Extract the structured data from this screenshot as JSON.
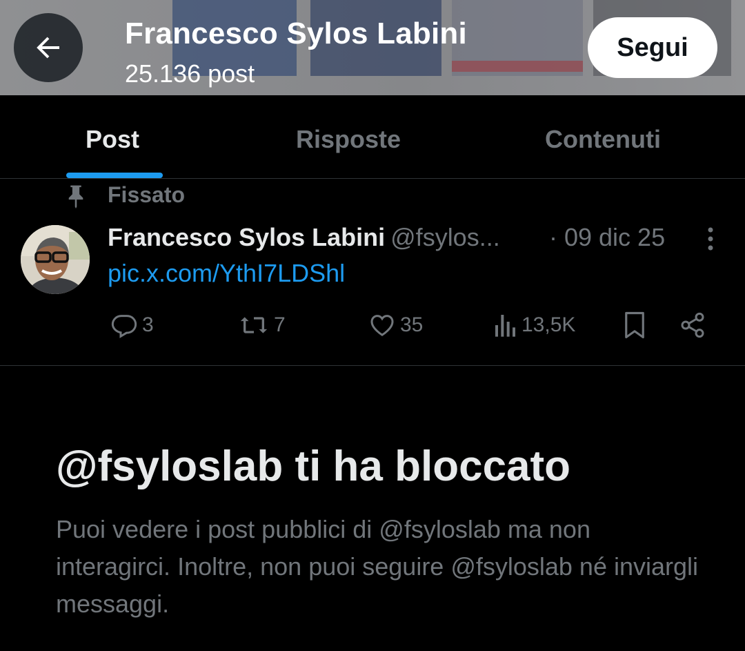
{
  "header": {
    "title": "Francesco Sylos Labini",
    "post_count": "25.136 post",
    "back_icon": "arrow-left-icon",
    "follow_label": "Segui"
  },
  "tabs": [
    {
      "label": "Post",
      "active": true
    },
    {
      "label": "Risposte",
      "active": false
    },
    {
      "label": "Contenuti",
      "active": false
    }
  ],
  "pinned_tweet": {
    "pinned_label": "Fissato",
    "pinned_icon": "pin-icon",
    "author_name": "Francesco Sylos Labini",
    "author_handle": "@fsylos...",
    "date": "· 09 dic 25",
    "link_text": "pic.x.com/YthI7LDShl",
    "actions": {
      "replies": "3",
      "reposts": "7",
      "likes": "35",
      "views": "13,5K"
    }
  },
  "blocked_notice": {
    "title": "@fsyloslab ti ha bloccato",
    "description": "Puoi vedere i post pubblici di @fsyloslab ma non interagirci. Inoltre, non puoi seguire @fsyloslab né inviargli messaggi."
  },
  "colors": {
    "background": "#000000",
    "accent": "#1d9bf0",
    "muted_text": "#71767b",
    "primary_text": "#e7e9ea"
  }
}
